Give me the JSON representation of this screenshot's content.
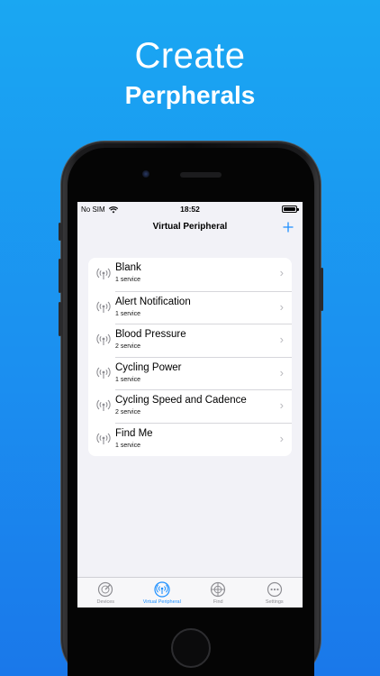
{
  "promo": {
    "headline": "Create",
    "subheadline": "Perpherals"
  },
  "status_bar": {
    "carrier": "No SIM",
    "time": "18:52"
  },
  "nav": {
    "title": "Virtual Peripheral",
    "add_icon": "plus-icon"
  },
  "peripherals": [
    {
      "name": "Blank",
      "services": "1 service"
    },
    {
      "name": "Alert Notification",
      "services": "1 service"
    },
    {
      "name": "Blood Pressure",
      "services": "2 service"
    },
    {
      "name": "Cycling Power",
      "services": "1 service"
    },
    {
      "name": "Cycling Speed and Cadence",
      "services": "2 service"
    },
    {
      "name": "Find Me",
      "services": "1 service"
    }
  ],
  "tabs": [
    {
      "label": "Devices",
      "icon": "radar-icon",
      "active": false
    },
    {
      "label": "Virtual Peripheral",
      "icon": "broadcast-icon",
      "active": true
    },
    {
      "label": "Find",
      "icon": "crosshair-icon",
      "active": false
    },
    {
      "label": "Settings",
      "icon": "more-icon",
      "active": false
    }
  ],
  "colors": {
    "accent": "#1e90ff",
    "inactive": "#8e8e93",
    "background": "#1a8ff0"
  }
}
